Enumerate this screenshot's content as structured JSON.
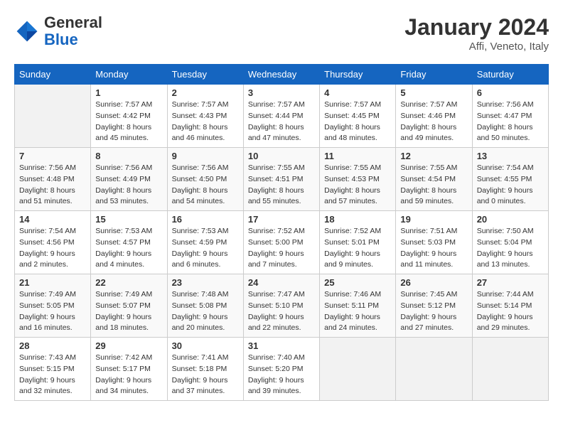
{
  "header": {
    "logo_general": "General",
    "logo_blue": "Blue",
    "month_year": "January 2024",
    "location": "Affi, Veneto, Italy"
  },
  "columns": [
    "Sunday",
    "Monday",
    "Tuesday",
    "Wednesday",
    "Thursday",
    "Friday",
    "Saturday"
  ],
  "weeks": [
    [
      {
        "day": "",
        "info": ""
      },
      {
        "day": "1",
        "info": "Sunrise: 7:57 AM\nSunset: 4:42 PM\nDaylight: 8 hours\nand 45 minutes."
      },
      {
        "day": "2",
        "info": "Sunrise: 7:57 AM\nSunset: 4:43 PM\nDaylight: 8 hours\nand 46 minutes."
      },
      {
        "day": "3",
        "info": "Sunrise: 7:57 AM\nSunset: 4:44 PM\nDaylight: 8 hours\nand 47 minutes."
      },
      {
        "day": "4",
        "info": "Sunrise: 7:57 AM\nSunset: 4:45 PM\nDaylight: 8 hours\nand 48 minutes."
      },
      {
        "day": "5",
        "info": "Sunrise: 7:57 AM\nSunset: 4:46 PM\nDaylight: 8 hours\nand 49 minutes."
      },
      {
        "day": "6",
        "info": "Sunrise: 7:56 AM\nSunset: 4:47 PM\nDaylight: 8 hours\nand 50 minutes."
      }
    ],
    [
      {
        "day": "7",
        "info": "Sunrise: 7:56 AM\nSunset: 4:48 PM\nDaylight: 8 hours\nand 51 minutes."
      },
      {
        "day": "8",
        "info": "Sunrise: 7:56 AM\nSunset: 4:49 PM\nDaylight: 8 hours\nand 53 minutes."
      },
      {
        "day": "9",
        "info": "Sunrise: 7:56 AM\nSunset: 4:50 PM\nDaylight: 8 hours\nand 54 minutes."
      },
      {
        "day": "10",
        "info": "Sunrise: 7:55 AM\nSunset: 4:51 PM\nDaylight: 8 hours\nand 55 minutes."
      },
      {
        "day": "11",
        "info": "Sunrise: 7:55 AM\nSunset: 4:53 PM\nDaylight: 8 hours\nand 57 minutes."
      },
      {
        "day": "12",
        "info": "Sunrise: 7:55 AM\nSunset: 4:54 PM\nDaylight: 8 hours\nand 59 minutes."
      },
      {
        "day": "13",
        "info": "Sunrise: 7:54 AM\nSunset: 4:55 PM\nDaylight: 9 hours\nand 0 minutes."
      }
    ],
    [
      {
        "day": "14",
        "info": "Sunrise: 7:54 AM\nSunset: 4:56 PM\nDaylight: 9 hours\nand 2 minutes."
      },
      {
        "day": "15",
        "info": "Sunrise: 7:53 AM\nSunset: 4:57 PM\nDaylight: 9 hours\nand 4 minutes."
      },
      {
        "day": "16",
        "info": "Sunrise: 7:53 AM\nSunset: 4:59 PM\nDaylight: 9 hours\nand 6 minutes."
      },
      {
        "day": "17",
        "info": "Sunrise: 7:52 AM\nSunset: 5:00 PM\nDaylight: 9 hours\nand 7 minutes."
      },
      {
        "day": "18",
        "info": "Sunrise: 7:52 AM\nSunset: 5:01 PM\nDaylight: 9 hours\nand 9 minutes."
      },
      {
        "day": "19",
        "info": "Sunrise: 7:51 AM\nSunset: 5:03 PM\nDaylight: 9 hours\nand 11 minutes."
      },
      {
        "day": "20",
        "info": "Sunrise: 7:50 AM\nSunset: 5:04 PM\nDaylight: 9 hours\nand 13 minutes."
      }
    ],
    [
      {
        "day": "21",
        "info": "Sunrise: 7:49 AM\nSunset: 5:05 PM\nDaylight: 9 hours\nand 16 minutes."
      },
      {
        "day": "22",
        "info": "Sunrise: 7:49 AM\nSunset: 5:07 PM\nDaylight: 9 hours\nand 18 minutes."
      },
      {
        "day": "23",
        "info": "Sunrise: 7:48 AM\nSunset: 5:08 PM\nDaylight: 9 hours\nand 20 minutes."
      },
      {
        "day": "24",
        "info": "Sunrise: 7:47 AM\nSunset: 5:10 PM\nDaylight: 9 hours\nand 22 minutes."
      },
      {
        "day": "25",
        "info": "Sunrise: 7:46 AM\nSunset: 5:11 PM\nDaylight: 9 hours\nand 24 minutes."
      },
      {
        "day": "26",
        "info": "Sunrise: 7:45 AM\nSunset: 5:12 PM\nDaylight: 9 hours\nand 27 minutes."
      },
      {
        "day": "27",
        "info": "Sunrise: 7:44 AM\nSunset: 5:14 PM\nDaylight: 9 hours\nand 29 minutes."
      }
    ],
    [
      {
        "day": "28",
        "info": "Sunrise: 7:43 AM\nSunset: 5:15 PM\nDaylight: 9 hours\nand 32 minutes."
      },
      {
        "day": "29",
        "info": "Sunrise: 7:42 AM\nSunset: 5:17 PM\nDaylight: 9 hours\nand 34 minutes."
      },
      {
        "day": "30",
        "info": "Sunrise: 7:41 AM\nSunset: 5:18 PM\nDaylight: 9 hours\nand 37 minutes."
      },
      {
        "day": "31",
        "info": "Sunrise: 7:40 AM\nSunset: 5:20 PM\nDaylight: 9 hours\nand 39 minutes."
      },
      {
        "day": "",
        "info": ""
      },
      {
        "day": "",
        "info": ""
      },
      {
        "day": "",
        "info": ""
      }
    ]
  ]
}
